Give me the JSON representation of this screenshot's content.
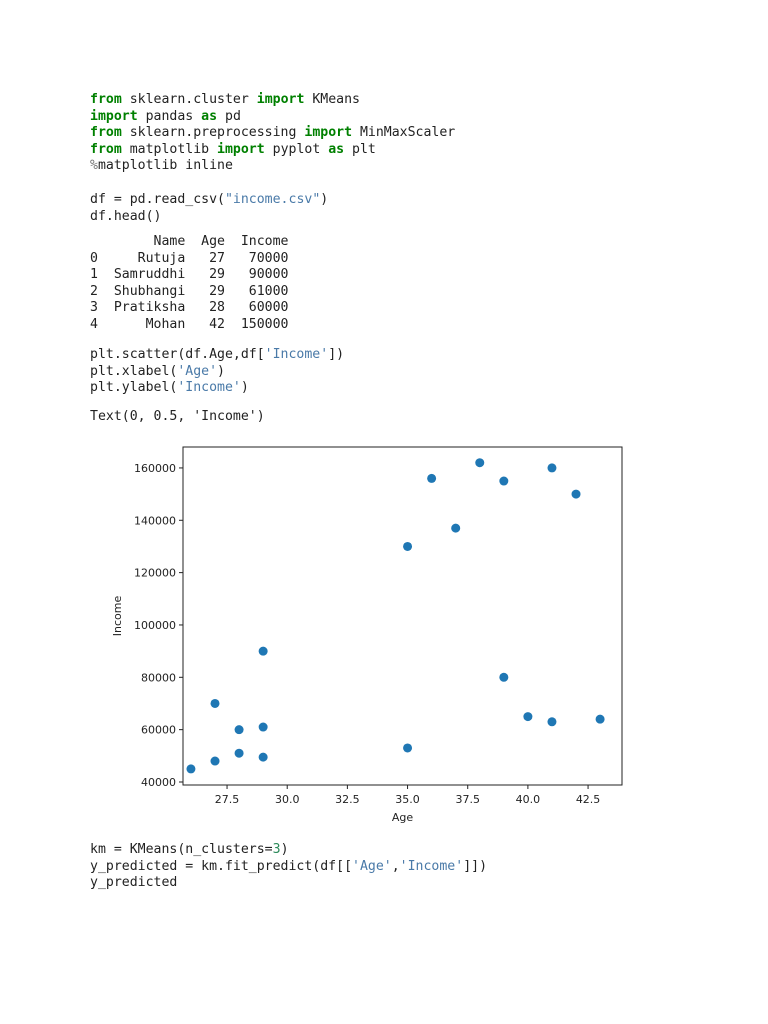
{
  "cells": [
    {
      "lines": [
        [
          [
            "kw",
            "from"
          ],
          [
            "t",
            " sklearn.cluster "
          ],
          [
            "kw",
            "import"
          ],
          [
            "t",
            " KMeans"
          ]
        ],
        [
          [
            "kw",
            "import"
          ],
          [
            "t",
            " pandas "
          ],
          [
            "kw",
            "as"
          ],
          [
            "t",
            " pd"
          ]
        ],
        [
          [
            "kw",
            "from"
          ],
          [
            "t",
            " sklearn.preprocessing "
          ],
          [
            "kw",
            "import"
          ],
          [
            "t",
            " MinMaxScaler"
          ]
        ],
        [
          [
            "kw",
            "from"
          ],
          [
            "t",
            " matplotlib "
          ],
          [
            "kw",
            "import"
          ],
          [
            "t",
            " pyplot "
          ],
          [
            "kw",
            "as"
          ],
          [
            "t",
            " plt"
          ]
        ],
        [
          [
            "mag",
            "%"
          ],
          [
            "t",
            "matplotlib inline"
          ]
        ]
      ]
    },
    {
      "lines": [
        [
          [
            "t",
            "df = pd.read_csv("
          ],
          [
            "str",
            "\"income.csv\""
          ],
          [
            "t",
            ")"
          ]
        ],
        [
          [
            "t",
            "df.head()"
          ]
        ]
      ]
    },
    {
      "lines": [
        [
          [
            "t",
            "        Name  Age  Income"
          ]
        ],
        [
          [
            "t",
            "0     Rutuja   27   70000"
          ]
        ],
        [
          [
            "t",
            "1  Samruddhi   29   90000"
          ]
        ],
        [
          [
            "t",
            "2  Shubhangi   29   61000"
          ]
        ],
        [
          [
            "t",
            "3  Pratiksha   28   60000"
          ]
        ],
        [
          [
            "t",
            "4      Mohan   42  150000"
          ]
        ]
      ]
    },
    {
      "lines": [
        [
          [
            "t",
            "plt.scatter(df.Age,df["
          ],
          [
            "str",
            "'Income'"
          ],
          [
            "t",
            "])"
          ]
        ],
        [
          [
            "t",
            "plt.xlabel("
          ],
          [
            "str",
            "'Age'"
          ],
          [
            "t",
            ")"
          ]
        ],
        [
          [
            "t",
            "plt.ylabel("
          ],
          [
            "str",
            "'Income'"
          ],
          [
            "t",
            ")"
          ]
        ]
      ]
    },
    {
      "lines": [
        [
          [
            "t",
            "Text(0, 0.5, 'Income')"
          ]
        ]
      ]
    },
    {
      "lines": [
        [
          [
            "t",
            "km = KMeans(n_clusters="
          ],
          [
            "num",
            "3"
          ],
          [
            "t",
            ")"
          ]
        ],
        [
          [
            "t",
            "y_predicted = km.fit_predict(df[["
          ],
          [
            "str",
            "'Age'"
          ],
          [
            "t",
            ","
          ],
          [
            "str",
            "'Income'"
          ],
          [
            "t",
            "]])"
          ]
        ],
        [
          [
            "t",
            "y_predicted"
          ]
        ]
      ]
    }
  ],
  "chart_data": {
    "type": "scatter",
    "title": "",
    "xlabel": "Age",
    "ylabel": "Income",
    "xlim": [
      25.67,
      43.91
    ],
    "ylim": [
      38850,
      168000
    ],
    "xticks": [
      27.5,
      30.0,
      32.5,
      35.0,
      37.5,
      40.0,
      42.5
    ],
    "xtick_labels": [
      "27.5",
      "30.0",
      "32.5",
      "35.0",
      "37.5",
      "40.0",
      "42.5"
    ],
    "yticks": [
      40000,
      60000,
      80000,
      100000,
      120000,
      140000,
      160000
    ],
    "ytick_labels": [
      "40000",
      "60000",
      "80000",
      "100000",
      "120000",
      "140000",
      "160000"
    ],
    "grid": false,
    "color": "#1f77b4",
    "points": [
      [
        27,
        70000
      ],
      [
        29,
        90000
      ],
      [
        29,
        61000
      ],
      [
        28,
        60000
      ],
      [
        42,
        150000
      ],
      [
        39,
        155000
      ],
      [
        41,
        160000
      ],
      [
        38,
        162000
      ],
      [
        36,
        156000
      ],
      [
        35,
        130000
      ],
      [
        37,
        137000
      ],
      [
        26,
        45000
      ],
      [
        27,
        48000
      ],
      [
        28,
        51000
      ],
      [
        29,
        49500
      ],
      [
        35,
        53000
      ],
      [
        39,
        80000
      ],
      [
        40,
        65000
      ],
      [
        41,
        63000
      ],
      [
        43,
        64000
      ]
    ]
  }
}
